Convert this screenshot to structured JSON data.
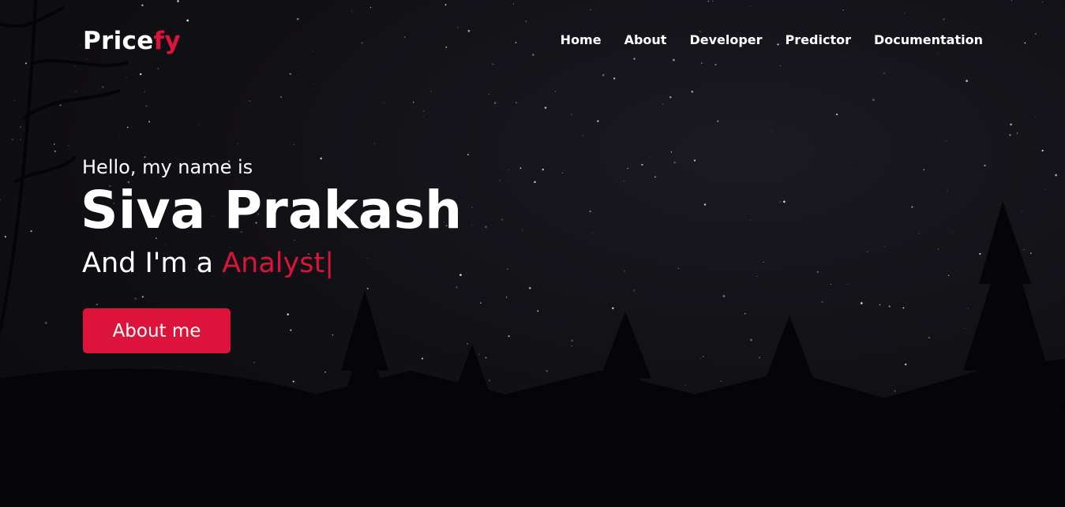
{
  "brand": {
    "name_part1": "Price",
    "name_part2": "fy",
    "accent_color": "#dc143c"
  },
  "nav": {
    "items": [
      {
        "label": "Home"
      },
      {
        "label": "About"
      },
      {
        "label": "Developer"
      },
      {
        "label": "Predictor"
      },
      {
        "label": "Documentation"
      }
    ]
  },
  "hero": {
    "greeting": "Hello, my name is",
    "name": "Siva Prakash",
    "role_prefix": "And I'm a",
    "role_typed": "Analyst",
    "cursor": "|",
    "button_label": "About me",
    "background": "night-sky-pine-silhouettes"
  }
}
